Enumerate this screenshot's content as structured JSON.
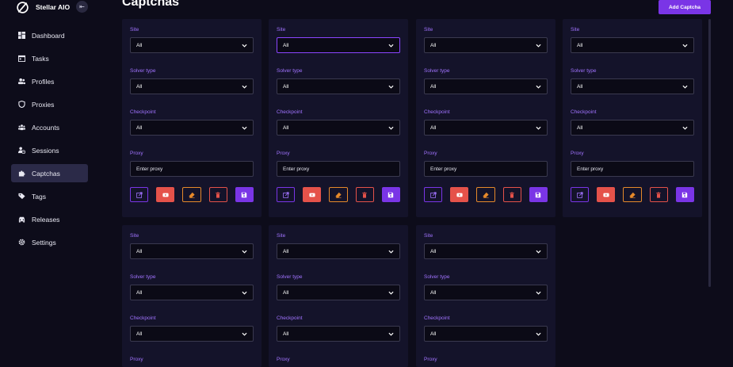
{
  "app": {
    "name": "Stellar AIO"
  },
  "header": {
    "title": "Captchas",
    "add_label": "Add Captcha"
  },
  "sidebar": {
    "items": [
      {
        "label": "Dashboard",
        "icon": "dashboard-icon",
        "active": false
      },
      {
        "label": "Tasks",
        "icon": "calendar-icon",
        "active": false
      },
      {
        "label": "Profiles",
        "icon": "people-icon",
        "active": false
      },
      {
        "label": "Proxies",
        "icon": "shield-icon",
        "active": false
      },
      {
        "label": "Accounts",
        "icon": "group-icon",
        "active": false
      },
      {
        "label": "Sessions",
        "icon": "user-clock-icon",
        "active": false
      },
      {
        "label": "Captchas",
        "icon": "puzzle-icon",
        "active": true
      },
      {
        "label": "Tags",
        "icon": "tag-icon",
        "active": false
      },
      {
        "label": "Releases",
        "icon": "car-icon",
        "active": false
      },
      {
        "label": "Settings",
        "icon": "gear-icon",
        "active": false
      }
    ]
  },
  "cards": [
    {
      "site_label": "Site",
      "site": "All",
      "solver_label": "Solver type",
      "solver": "All",
      "checkpoint_label": "Checkpoint",
      "checkpoint": "All",
      "proxy_label": "Proxy",
      "proxy_placeholder": "Enter proxy"
    },
    {
      "site_label": "Site",
      "site": "All",
      "solver_label": "Solver type",
      "solver": "All",
      "checkpoint_label": "Checkpoint",
      "checkpoint": "All",
      "proxy_label": "Proxy",
      "proxy_placeholder": "Enter proxy"
    },
    {
      "site_label": "Site",
      "site": "All",
      "solver_label": "Solver type",
      "solver": "All",
      "checkpoint_label": "Checkpoint",
      "checkpoint": "All",
      "proxy_label": "Proxy",
      "proxy_placeholder": "Enter proxy"
    },
    {
      "site_label": "Site",
      "site": "All",
      "solver_label": "Solver type",
      "solver": "All",
      "checkpoint_label": "Checkpoint",
      "checkpoint": "All",
      "proxy_label": "Proxy",
      "proxy_placeholder": "Enter proxy"
    },
    {
      "site_label": "Site",
      "site": "All",
      "solver_label": "Solver type",
      "solver": "All",
      "checkpoint_label": "Checkpoint",
      "checkpoint": "All",
      "proxy_label": "Proxy"
    },
    {
      "site_label": "Site",
      "site": "All",
      "solver_label": "Solver type",
      "solver": "All",
      "checkpoint_label": "Checkpoint",
      "checkpoint": "All",
      "proxy_label": "Proxy"
    },
    {
      "site_label": "Site",
      "site": "All",
      "solver_label": "Solver type",
      "solver": "All",
      "checkpoint_label": "Checkpoint",
      "checkpoint": "All",
      "proxy_label": "Proxy"
    }
  ],
  "colors": {
    "accent": "#7a35e6",
    "danger": "#e5524a",
    "warning": "#e6892a",
    "card": "#14132a",
    "background": "#0d0c1a"
  }
}
